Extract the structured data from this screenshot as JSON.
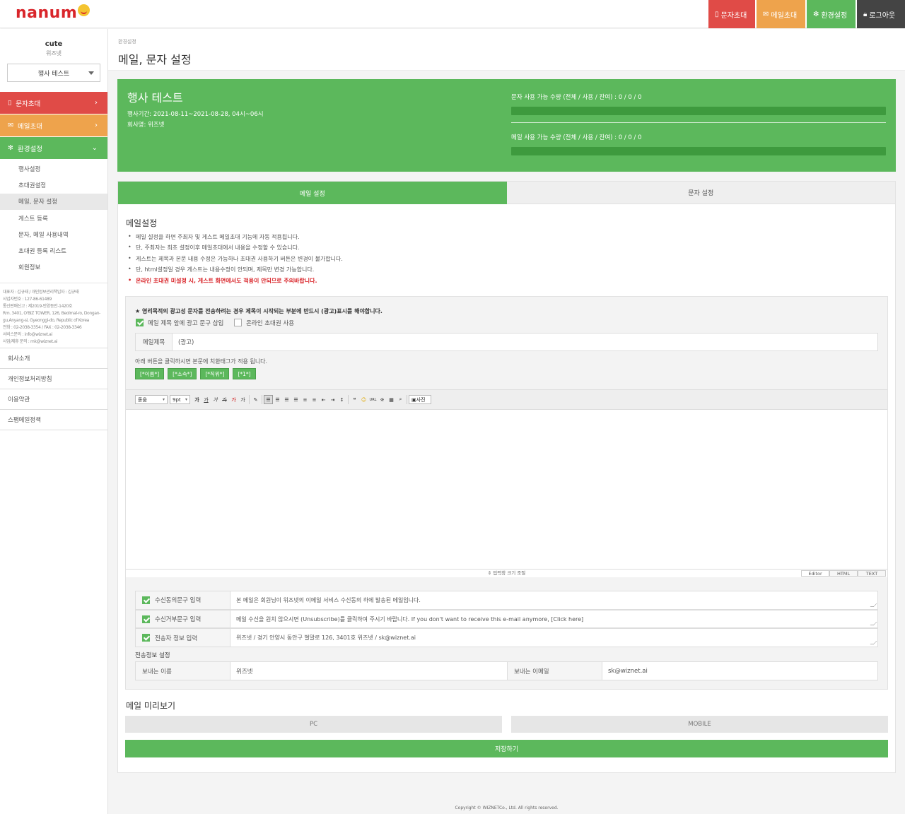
{
  "brand": {
    "logo_text": "nanum",
    "logo_color": "#d9262b"
  },
  "topnav": {
    "sms": "문자초대",
    "mail": "메일초대",
    "settings": "환경설정",
    "logout": "로그아웃"
  },
  "sidebar": {
    "user_name": "cute",
    "user_company": "위즈넷",
    "event_select": "행사 테스트",
    "menu": [
      {
        "label": "문자초대",
        "arrow": "›"
      },
      {
        "label": "메일초대",
        "arrow": "›"
      },
      {
        "label": "환경설정",
        "arrow": "⌄"
      }
    ],
    "sub_items": [
      "행사설정",
      "초대권설정",
      "메일, 문자 설정",
      "게스트 등록",
      "문자, 메일 사용내역",
      "초대권 등록 리스트",
      "회원정보"
    ],
    "company_info": [
      "대표자 : 김규태 / 개인정보관리책임자 : 김규태",
      "사업자번호 : 127-86-61489",
      "통신판매신고 : 제2019-안양동안-1420호",
      "Rm. 3401, O'BIZ TOWER, 126, Beolmal-ro, Dongan-",
      "gu,Anyang-si, Gyeonggi-do, Republic of Korea",
      "전화 : 02-2038-3354 / FAX : 02-2038-3346",
      "서비스문의 : info@wiznet.ai",
      "사업/제휴 문의 : mk@wiznet.ai"
    ],
    "links": [
      "회사소개",
      "개인정보처리방침",
      "이용약관",
      "스팸메일정책"
    ]
  },
  "page": {
    "breadcrumb": "환경설정",
    "title": "메일, 문자 설정"
  },
  "summary": {
    "event_title": "행사 테스트",
    "period": "행사기간: 2021-08-11~2021-08-28, 04시~06시",
    "company": "회사명: 위즈넷",
    "sms_quota": "문자 사용 가능 수량 (전체 / 사용 / 잔여) : 0 / 0 / 0",
    "mail_quota": "메일 사용 가능 수량 (전체 / 사용 / 잔여) : 0 / 0 / 0",
    "sms_used_fraction": 0,
    "mail_used_fraction": 0
  },
  "tabs": {
    "mail": "메일 설정",
    "sms": "문자 설정"
  },
  "mail_settings": {
    "section_title": "메일설정",
    "notes": [
      "메일 설정을 하면 주최자 및 게스트 메일초대 기능에 자동 적용됩니다.",
      "단, 주최자는 최초 설정이후 메일초대에서 내용을 수정할 수 있습니다.",
      "게스트는 제목과 본문 내용 수정은 가능하나 초대권 사용하기 버튼은 변경이 불가합니다.",
      "단, html설정일 경우 게스트는 내용수정이 안되며, 제목만 변경 가능합니다.",
      "온라인 초대권 미설정 시, 게스트 화면에서도 적용이 안되므로 주의바랍니다."
    ],
    "ad_notice": "★ 영리목적의 광고성 문자를 전송하려는 경우 제목이 시작되는 부분에 반드시 (광고)표시를 해야합니다.",
    "chk_ad_label": "메일 제목 앞에 광고 문구 삽입",
    "chk_online_label": "온라인 초대권 사용",
    "subject_label": "메일제목",
    "subject_value": "(광고)",
    "tag_hint": "아래 버튼을 클릭하시면 본문에 치환태그가 적용 됩니다.",
    "tags": [
      "[*이름*]",
      "[*소속*]",
      "[*직위*]",
      "[*1*]"
    ],
    "editor": {
      "font": "돋움",
      "size": "9pt",
      "resize_label": "⇕ 입력창 크기 조절",
      "modes": [
        "Editor",
        "HTML",
        "TEXT"
      ],
      "photo_label": "사진"
    },
    "options": [
      {
        "label": "수신동의문구 입력",
        "value": "본 메일은 회원님이 위즈넷의 이메일 서비스 수신동의 하에 발송된 메일입니다."
      },
      {
        "label": "수신거부문구 입력",
        "value": "메일 수신을 원치 않으시면 (Unsubscribe)를 클릭하여 주시기 바랍니다. If you don't want to receive this e-mail anymore, [Click here]"
      },
      {
        "label": "전송자 정보 입력",
        "value": "위즈넷 / 경기 안양시 동안구 벌말로 126, 3401호 위즈넷 / sk@wiznet.ai"
      }
    ],
    "sender_section": "전송정보 설정",
    "sender_name_label": "보내는 이름",
    "sender_name": "위즈넷",
    "sender_email_label": "보내는 이메일",
    "sender_email": "sk@wiznet.ai",
    "preview_title": "메일 미리보기",
    "preview_pc": "PC",
    "preview_mobile": "MOBILE",
    "save": "저장하기"
  },
  "footer": "Copyright © WIZNETCo., Ltd. All rights reserved.",
  "colors": {
    "green": "#5cb85c",
    "red": "#e04b47",
    "orange": "#eea34c",
    "dark": "#444444"
  }
}
